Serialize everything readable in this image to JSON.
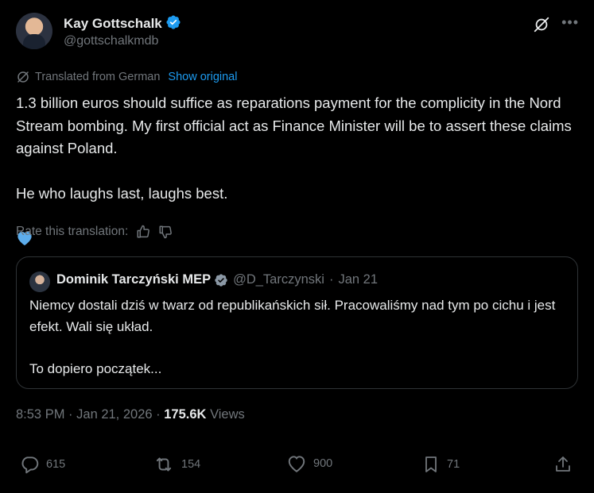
{
  "author": {
    "name": "Kay Gottschalk",
    "handle": "@gottschalkmdb"
  },
  "translation": {
    "label": "Translated from German",
    "show_original": "Show original",
    "rate_label": "Rate this translation:"
  },
  "tweet": {
    "paragraphs": [
      "1.3 billion euros should suffice as reparations payment for the complicity in the Nord Stream bombing. My first official act as Finance Minister will be to assert these claims against Poland.",
      "He who laughs last, laughs best."
    ]
  },
  "quote": {
    "name": "Dominik Tarczyński MEP",
    "handle": "@D_Tarczynski",
    "separator": "·",
    "date": "Jan 21",
    "paragraphs": [
      "Niemcy dostali dziś w twarz od republikańskich sił. Pracowaliśmy nad tym po cichu i jest efekt. Wali się układ.",
      "To dopiero początek..."
    ]
  },
  "meta": {
    "time": "8:53 PM",
    "separator": "·",
    "date": "Jan 21, 2026",
    "views_count": "175.6K",
    "views_label": "Views"
  },
  "actions": {
    "replies": "615",
    "reposts": "154",
    "likes": "900",
    "bookmarks": "71"
  },
  "colors": {
    "background": "#000000",
    "text": "#e7e9ea",
    "muted": "#71767b",
    "link": "#1d9bf0",
    "border": "#2f3336",
    "verified": "#1d9bf0"
  }
}
